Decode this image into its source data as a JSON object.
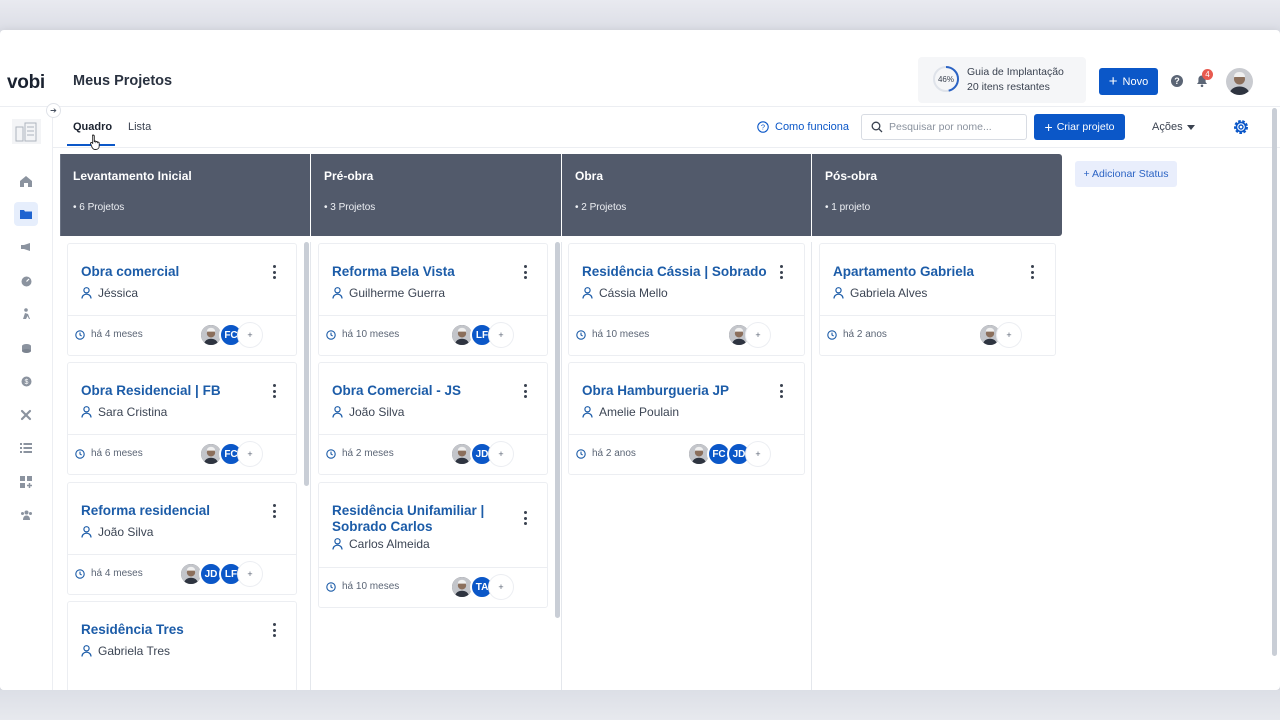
{
  "app": {
    "logo": "vobi",
    "page_title": "Meus Projetos",
    "guide": {
      "percent": "46%",
      "title": "Guia de Implantação",
      "subtitle": "20 itens restantes"
    },
    "new_button": "Novo",
    "notifications_count": "4",
    "colors": {
      "primary": "#0b57c8",
      "column_header": "#525a6b",
      "card_title": "#1c5ca8",
      "badge": "#e85a4f"
    }
  },
  "tabs": [
    {
      "label": "Quadro",
      "active": true
    },
    {
      "label": "Lista",
      "active": false
    }
  ],
  "toolbar": {
    "how_it_works": "Como funciona",
    "search_placeholder": "Pesquisar por nome...",
    "create_button": "Criar projeto",
    "actions": "Ações"
  },
  "add_status": "+ Adicionar Status",
  "columns": [
    {
      "title": "Levantamento Inicial",
      "count": "• 6 Projetos",
      "cards": [
        {
          "title": "Obra comercial",
          "owner": "Jéssica",
          "time": "há 4 meses",
          "avatars": [
            "photo",
            "FC"
          ]
        },
        {
          "title": "Obra Residencial | FB",
          "owner": "Sara Cristina",
          "time": "há 6 meses",
          "avatars": [
            "photo",
            "FC"
          ]
        },
        {
          "title": "Reforma residencial",
          "owner": "João Silva",
          "time": "há 4 meses",
          "avatars": [
            "photo",
            "JD",
            "LF"
          ]
        },
        {
          "title": "Residência Tres",
          "owner": "Gabriela Tres",
          "time": "",
          "avatars": []
        }
      ]
    },
    {
      "title": "Pré-obra",
      "count": "• 3 Projetos",
      "cards": [
        {
          "title": "Reforma Bela Vista",
          "owner": "Guilherme Guerra",
          "time": "há 10 meses",
          "avatars": [
            "photo",
            "LF"
          ]
        },
        {
          "title": "Obra Comercial - JS",
          "owner": "João Silva",
          "time": "há 2 meses",
          "avatars": [
            "photo",
            "JD"
          ]
        },
        {
          "title": "Residência Unifamiliar | Sobrado Carlos",
          "owner": "Carlos Almeida",
          "time": "há 10 meses",
          "avatars": [
            "photo",
            "TA"
          ]
        }
      ]
    },
    {
      "title": "Obra",
      "count": "• 2 Projetos",
      "cards": [
        {
          "title": "Residência Cássia | Sobrado",
          "owner": "Cássia Mello",
          "time": "há 10 meses",
          "avatars": [
            "photo"
          ]
        },
        {
          "title": "Obra Hamburgueria JP",
          "owner": "Amelie Poulain",
          "time": "há 2 anos",
          "avatars": [
            "photo",
            "FC",
            "JD"
          ]
        }
      ]
    },
    {
      "title": "Pós-obra",
      "count": "• 1 projeto",
      "cards": [
        {
          "title": "Apartamento Gabriela",
          "owner": "Gabriela Alves",
          "time": "há 2 anos",
          "avatars": [
            "photo"
          ]
        }
      ]
    }
  ],
  "sidebar_icons": [
    "home-icon",
    "folder-icon",
    "megaphone-icon",
    "gauge-icon",
    "worker-icon",
    "coins-icon",
    "dollar-icon",
    "tools-icon",
    "list-icon",
    "add-grid-icon",
    "team-icon"
  ]
}
